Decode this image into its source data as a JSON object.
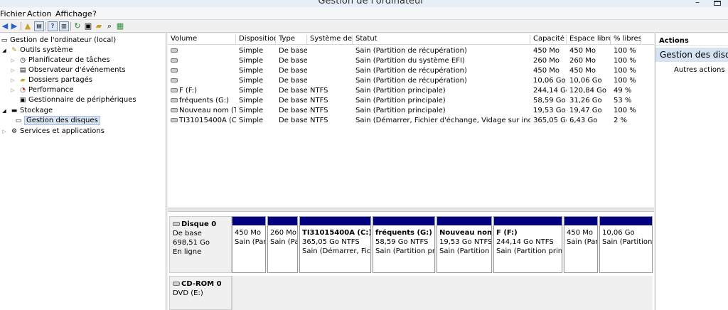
{
  "window": {
    "title": "Gestion de l'ordinateur",
    "minimize_glyph": "–"
  },
  "menu": [
    "Fichier",
    "Action",
    "Affichage",
    "?"
  ],
  "tree": [
    {
      "label": "Gestion de l'ordinateur (local)",
      "icon": "computer-icon"
    },
    {
      "label": "Outils système",
      "icon": "tools-icon"
    },
    {
      "label": "Planificateur de tâches",
      "icon": "clock-icon"
    },
    {
      "label": "Observateur d'événements",
      "icon": "event-viewer-icon"
    },
    {
      "label": "Dossiers partagés",
      "icon": "shared-folder-icon"
    },
    {
      "label": "Performance",
      "icon": "performance-icon"
    },
    {
      "label": "Gestionnaire de périphériques",
      "icon": "device-manager-icon"
    },
    {
      "label": "Stockage",
      "icon": "storage-icon"
    },
    {
      "label": "Gestion des disques",
      "icon": "disk-icon"
    },
    {
      "label": "Services et applications",
      "icon": "services-icon"
    }
  ],
  "table": {
    "columns": [
      "Volume",
      "Disposition",
      "Type",
      "Système de...",
      "Statut",
      "Capacité",
      "Espace libre",
      "% libres"
    ],
    "rows": [
      [
        "",
        "Simple",
        "De base",
        "",
        "Sain (Partition de récupération)",
        "450 Mo",
        "450 Mo",
        "100 %"
      ],
      [
        "",
        "Simple",
        "De base",
        "",
        "Sain (Partition du système EFI)",
        "260 Mo",
        "260 Mo",
        "100 %"
      ],
      [
        "",
        "Simple",
        "De base",
        "",
        "Sain (Partition de récupération)",
        "450 Mo",
        "450 Mo",
        "100 %"
      ],
      [
        "",
        "Simple",
        "De base",
        "",
        "Sain (Partition de récupération)",
        "10,06 Go",
        "10,06 Go",
        "100 %"
      ],
      [
        "F (F:)",
        "Simple",
        "De base",
        "NTFS",
        "Sain (Partition principale)",
        "244,14 Go",
        "120,84 Go",
        "49 %"
      ],
      [
        "fréquents (G:)",
        "Simple",
        "De base",
        "NTFS",
        "Sain (Partition principale)",
        "58,59 Go",
        "31,26 Go",
        "53 %"
      ],
      [
        "Nouveau nom (T:)",
        "Simple",
        "De base",
        "NTFS",
        "Sain (Partition principale)",
        "19,53 Go",
        "19,47 Go",
        "100 %"
      ],
      [
        "TI31015400A (C:)",
        "Simple",
        "De base",
        "NTFS",
        "Sain (Démarrer, Fichier d'échange, Vidage sur inciden...",
        "365,05 Go",
        "6,43 Go",
        "2 %"
      ]
    ]
  },
  "disk0": {
    "name": "Disque 0",
    "type": "De base",
    "size": "698,51 Go",
    "status": "En ligne",
    "partitions": [
      {
        "title": "",
        "size": "450 Mo",
        "status": "Sain (Par"
      },
      {
        "title": "",
        "size": "260 Mo",
        "status": "Sain (Pa"
      },
      {
        "title": "TI31015400A  (C:)",
        "size": "365,05 Go NTFS",
        "status": "Sain (Démarrer, Fichie"
      },
      {
        "title": "fréquents  (G:)",
        "size": "58,59 Go NTFS",
        "status": "Sain (Partition prin"
      },
      {
        "title": "Nouveau nom",
        "size": "19,53 Go NTFS",
        "status": "Sain (Partition p"
      },
      {
        "title": "F  (F:)",
        "size": "244,14 Go NTFS",
        "status": "Sain (Partition princi"
      },
      {
        "title": "",
        "size": "450 Mo",
        "status": "Sain (Parti"
      },
      {
        "title": "",
        "size": "10,06 Go",
        "status": "Sain (Partition c"
      }
    ]
  },
  "cdrom0": {
    "name": "CD-ROM 0",
    "type": "DVD (E:)"
  },
  "actions": {
    "header": "Actions",
    "selected": "Gestion des disq...",
    "other": "Autres actions"
  },
  "colors": {
    "partition_bar": "#00007f",
    "selection": "#d6e3f3"
  }
}
